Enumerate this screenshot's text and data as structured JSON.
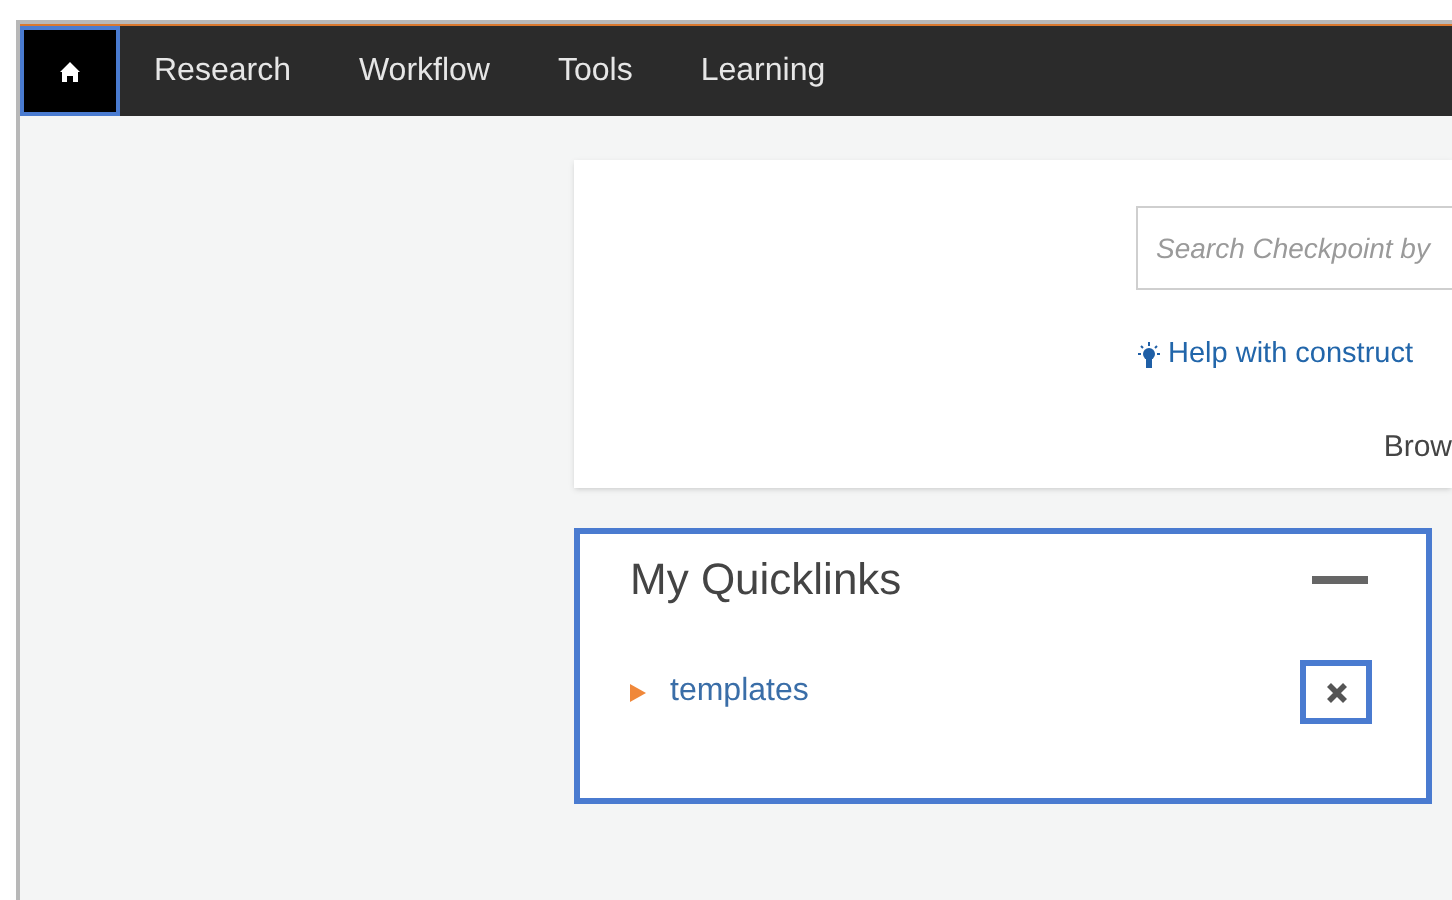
{
  "nav": {
    "items": [
      {
        "kind": "icon",
        "selected": true
      },
      {
        "kind": "text",
        "label": "Research",
        "selected": false
      },
      {
        "kind": "text",
        "label": "Workflow",
        "selected": false
      },
      {
        "kind": "text",
        "label": "Tools",
        "selected": false
      },
      {
        "kind": "text",
        "label": "Learning",
        "selected": false
      }
    ]
  },
  "search_card": {
    "search": {
      "placeholder": "Search Checkpoint by"
    },
    "help_link": "Help with construct",
    "browse_text": "Brow"
  },
  "quicklinks": {
    "title": "My Quicklinks",
    "highlighted": true,
    "items": [
      {
        "label": "templates",
        "close_highlighted": true
      }
    ]
  }
}
